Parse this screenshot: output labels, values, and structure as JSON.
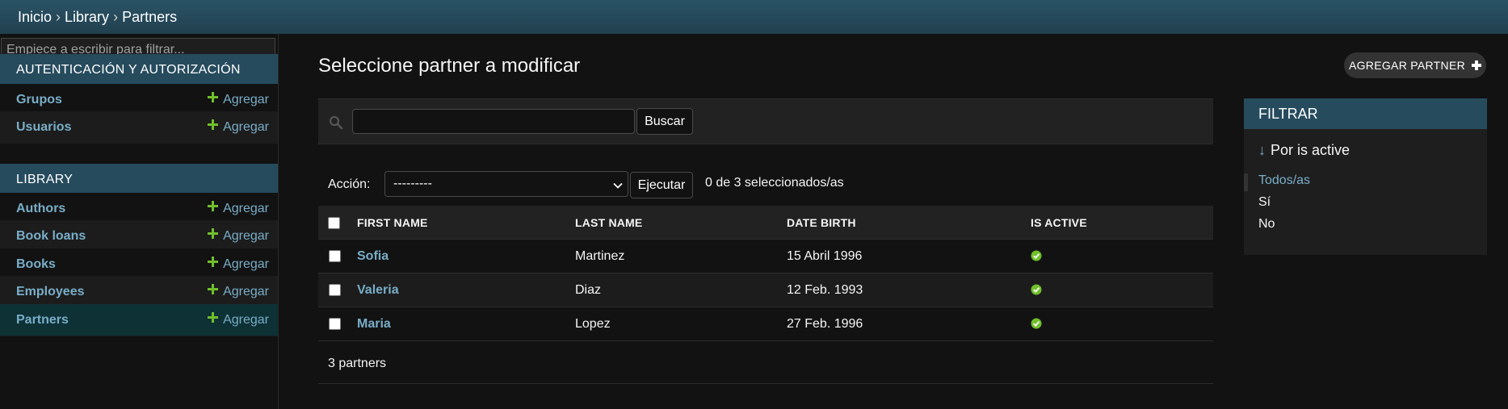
{
  "breadcrumb": {
    "items": [
      "Inicio",
      "Library",
      "Partners"
    ],
    "separator": "›"
  },
  "sidebar": {
    "filter_placeholder": "Empiece a escribir para filtrar...",
    "modules": [
      {
        "caption": "AUTENTICACIÓN Y AUTORIZACIÓN",
        "models": [
          {
            "name": "Grupos",
            "add_label": "Agregar"
          },
          {
            "name": "Usuarios",
            "add_label": "Agregar"
          }
        ]
      },
      {
        "caption": "LIBRARY",
        "models": [
          {
            "name": "Authors",
            "add_label": "Agregar"
          },
          {
            "name": "Book loans",
            "add_label": "Agregar"
          },
          {
            "name": "Books",
            "add_label": "Agregar"
          },
          {
            "name": "Employees",
            "add_label": "Agregar"
          },
          {
            "name": "Partners",
            "add_label": "Agregar",
            "current": true
          }
        ]
      }
    ]
  },
  "main": {
    "title": "Seleccione partner a modificar",
    "add_button": "AGREGAR PARTNER",
    "search": {
      "value": "",
      "button": "Buscar"
    },
    "actions": {
      "label": "Acción:",
      "selected": "---------",
      "run_button": "Ejecutar",
      "counter": "0 de 3 seleccionados/as"
    },
    "table": {
      "columns": [
        "FIRST NAME",
        "LAST NAME",
        "DATE BIRTH",
        "IS ACTIVE"
      ],
      "rows": [
        {
          "first_name": "Sofia",
          "last_name": "Martinez",
          "date_birth": "15 Abril 1996",
          "is_active": true
        },
        {
          "first_name": "Valeria",
          "last_name": "Diaz",
          "date_birth": "12 Feb. 1993",
          "is_active": true
        },
        {
          "first_name": "Maria",
          "last_name": "Lopez",
          "date_birth": "27 Feb. 1996",
          "is_active": true
        }
      ]
    },
    "result_count": "3 partners"
  },
  "filter": {
    "caption": "FILTRAR",
    "heading_arrow": "↓",
    "heading": "Por is active",
    "options": [
      "Todos/as",
      "Sí",
      "No"
    ],
    "selected": "Todos/as"
  },
  "colors": {
    "header_bg": "#264b5d",
    "link": "#79aec8",
    "add_green": "#70bf2b",
    "body_bg": "#121212"
  },
  "icons": {
    "add": "plus-icon",
    "search": "search-icon",
    "boolean_true": "check-circle-icon",
    "select_arrow": "chevron-down-icon"
  }
}
